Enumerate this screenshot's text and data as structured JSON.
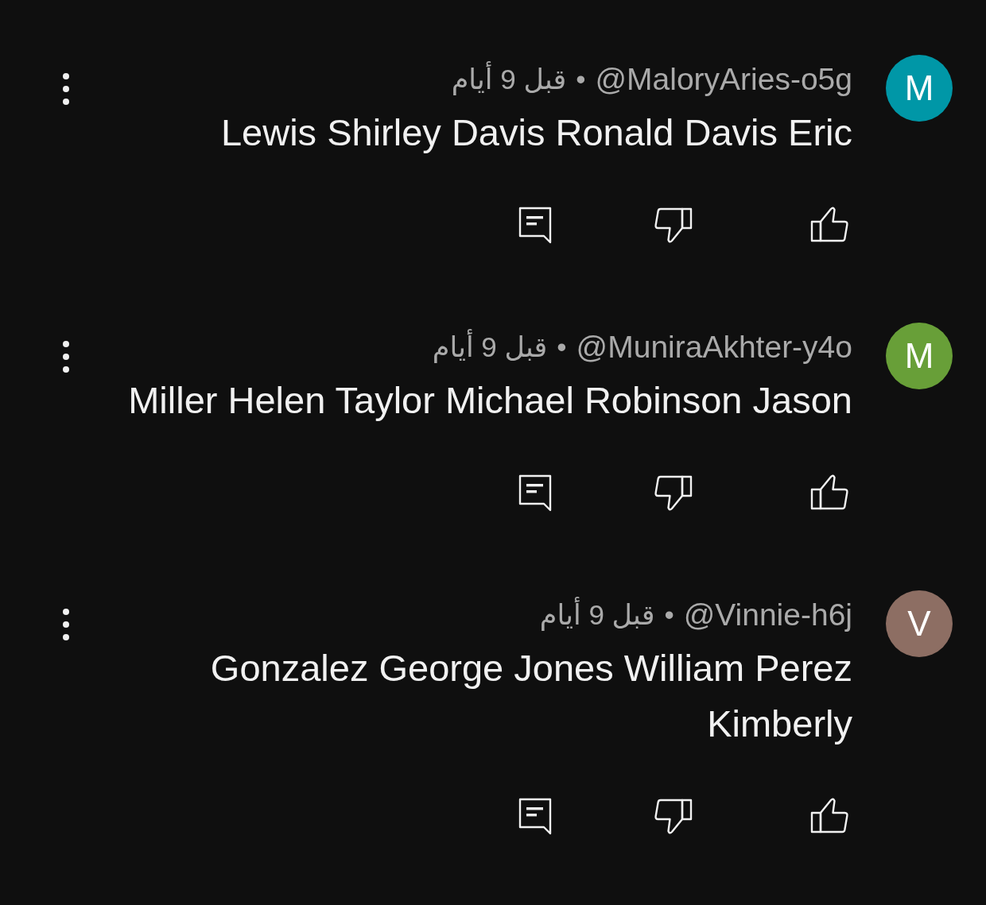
{
  "comments": [
    {
      "avatar": {
        "letter": "M",
        "color": "#0097a7"
      },
      "author": "@MaloryAries-o5g",
      "separator": "•",
      "time": "قبل 9 أيام",
      "text": "Lewis Shirley Davis Ronald Davis Eric",
      "actions": [
        {
          "kind": "reply"
        },
        {
          "kind": "dislike"
        },
        {
          "kind": "like"
        }
      ]
    },
    {
      "avatar": {
        "letter": "M",
        "color": "#689f38"
      },
      "author": "@MuniraAkhter-y4o",
      "separator": "•",
      "time": "قبل 9 أيام",
      "text": "Miller Helen Taylor Michael Robinson Jason",
      "actions": [
        {
          "kind": "reply"
        },
        {
          "kind": "dislike"
        },
        {
          "kind": "like"
        }
      ]
    },
    {
      "avatar": {
        "letter": "V",
        "color": "#8d6e63"
      },
      "author": "@Vinnie-h6j",
      "separator": "•",
      "time": "قبل 9 أيام",
      "text": "Gonzalez George Jones William Perez Kimberly",
      "actions": [
        {
          "kind": "reply"
        },
        {
          "kind": "dislike"
        },
        {
          "kind": "like"
        }
      ]
    }
  ]
}
